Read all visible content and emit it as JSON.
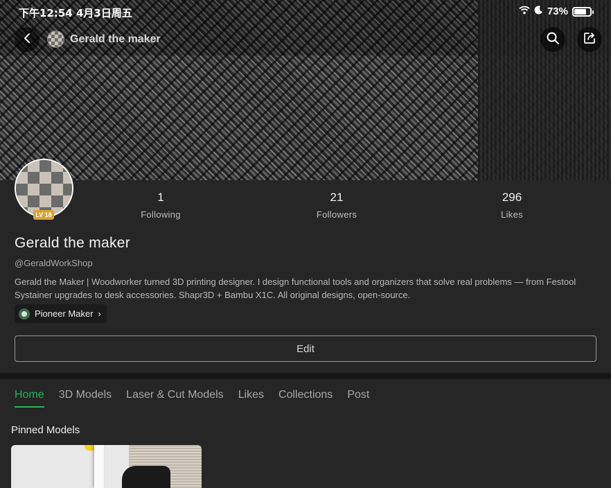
{
  "status_bar": {
    "time": "下午12:54  4月3日周五",
    "battery": "73%"
  },
  "nav": {
    "title": "Gerald the maker"
  },
  "profile": {
    "level": "LV 18",
    "name": "Gerald the maker",
    "handle": "@GeraldWorkShop",
    "bio": "Gerald the Maker | Woodworker turned 3D printing designer. I design functional tools and organizers that solve real problems — from Festool Systainer upgrades to desk accessories. Shapr3D + Bambu X1C. All original designs, open-source.",
    "badge": "Pioneer Maker",
    "badge_chevron": "›",
    "edit_label": "Edit"
  },
  "stats": [
    {
      "value": "1",
      "label": "Following"
    },
    {
      "value": "21",
      "label": "Followers"
    },
    {
      "value": "296",
      "label": "Likes"
    }
  ],
  "tabs": [
    {
      "label": "Home",
      "active": true
    },
    {
      "label": "3D Models",
      "active": false
    },
    {
      "label": "Laser & Cut Models",
      "active": false
    },
    {
      "label": "Likes",
      "active": false
    },
    {
      "label": "Collections",
      "active": false
    },
    {
      "label": "Post",
      "active": false
    }
  ],
  "sections": {
    "pinned_title": "Pinned Models"
  },
  "colors": {
    "accent": "#21b35b",
    "background": "#262626",
    "level_badge": "#d8a534"
  },
  "icons": {
    "back": "chevron-left-icon",
    "search": "search-icon",
    "share": "share-icon",
    "wifi": "wifi-icon",
    "moon": "moon-icon",
    "battery": "battery-icon"
  }
}
